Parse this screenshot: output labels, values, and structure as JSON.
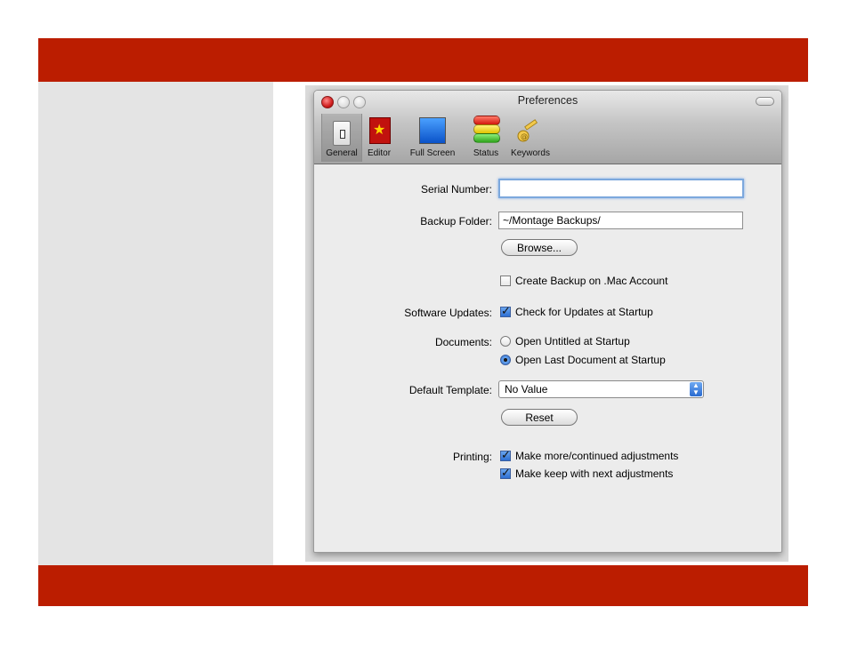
{
  "window": {
    "title": "Preferences"
  },
  "toolbar": {
    "items": [
      {
        "label": "General",
        "icon": "general-switch-icon",
        "selected": true
      },
      {
        "label": "Editor",
        "icon": "editor-star-icon"
      },
      {
        "label": "Full Screen",
        "icon": "full-screen-icon"
      },
      {
        "label": "Status",
        "icon": "status-bars-icon"
      },
      {
        "label": "Keywords",
        "icon": "keywords-key-icon"
      }
    ]
  },
  "form": {
    "serial_number": {
      "label": "Serial Number:",
      "value": ""
    },
    "backup_folder": {
      "label": "Backup Folder:",
      "value": "~/Montage Backups/"
    },
    "browse_button": "Browse...",
    "mac_backup": {
      "label": "Create Backup on .Mac Account",
      "checked": false
    },
    "software_updates": {
      "label": "Software Updates:",
      "option": "Check for Updates at Startup",
      "checked": true
    },
    "documents": {
      "label": "Documents:",
      "options": [
        {
          "label": "Open Untitled at Startup",
          "selected": false
        },
        {
          "label": "Open Last Document at Startup",
          "selected": true
        }
      ]
    },
    "default_template": {
      "label": "Default Template:",
      "value": "No Value"
    },
    "reset_button": "Reset",
    "printing": {
      "label": "Printing:",
      "options": [
        {
          "label": "Make more/continued adjustments",
          "checked": true
        },
        {
          "label": "Make keep with next adjustments",
          "checked": true
        }
      ]
    }
  },
  "colors": {
    "band": "#bb1d00",
    "sidebar": "#e4e4e4",
    "window": "#ececec"
  }
}
